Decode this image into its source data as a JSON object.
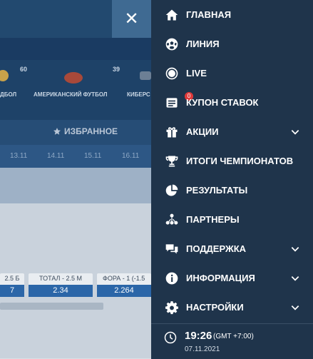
{
  "background": {
    "sports": [
      {
        "label": "ДБОЛ",
        "count": ""
      },
      {
        "label": "АМЕРИКАНСКИЙ ФУТБОЛ",
        "count": "60"
      },
      {
        "label": "КИБЕРС",
        "count": "39"
      }
    ],
    "favorites_label": "ИЗБРАННОЕ",
    "dates": [
      "13.11",
      "14.11",
      "15.11",
      "16.11"
    ],
    "odds": [
      {
        "label": "2.5 Б",
        "value": "7"
      },
      {
        "label": "ТОТАЛ - 2.5 М",
        "value": "2.34"
      },
      {
        "label": "ФОРА - 1 (-1.5",
        "value": "2.264"
      }
    ],
    "close_icon": "close-icon"
  },
  "menu": {
    "items": [
      {
        "label": "ГЛАВНАЯ",
        "icon": "home-icon"
      },
      {
        "label": "ЛИНИЯ",
        "icon": "soccer-ball-icon"
      },
      {
        "label": "LIVE",
        "icon": "live-icon"
      },
      {
        "label": "КУПОН СТАВОК",
        "icon": "coupon-icon",
        "badge": "0"
      },
      {
        "label": "АКЦИИ",
        "icon": "gift-icon"
      },
      {
        "label": "ИТОГИ ЧЕМПИОНАТОВ",
        "icon": "trophy-icon"
      },
      {
        "label": "РЕЗУЛЬТАТЫ",
        "icon": "pie-chart-icon"
      },
      {
        "label": "ПАРТНЕРЫ",
        "icon": "partners-icon"
      },
      {
        "label": "ПОДДЕРЖКА",
        "icon": "support-icon"
      },
      {
        "label": "ИНФОРМАЦИЯ",
        "icon": "info-icon"
      },
      {
        "label": "НАСТРОЙКИ",
        "icon": "settings-icon"
      }
    ]
  },
  "footer": {
    "time": "19:26",
    "timezone": "(GMT +7:00)",
    "date": "07.11.2021"
  },
  "colors": {
    "drawer_bg": "#1f344b",
    "badge": "#e03a3a",
    "accent_blue": "#2b66a8"
  }
}
